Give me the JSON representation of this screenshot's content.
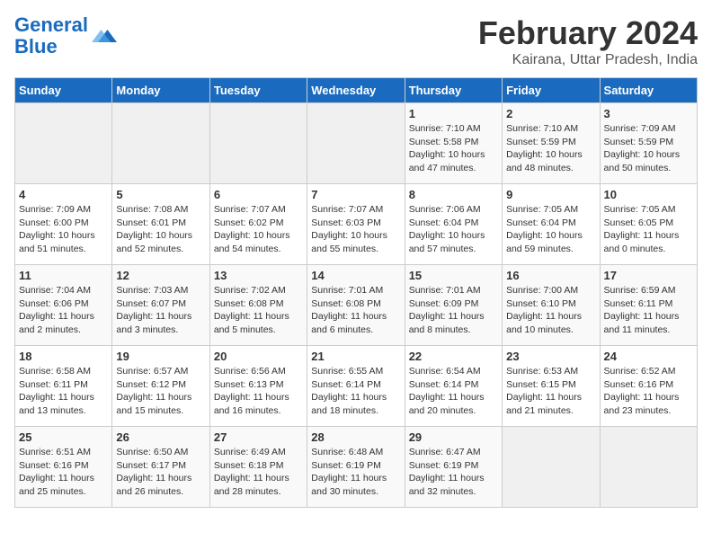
{
  "header": {
    "logo_line1": "General",
    "logo_line2": "Blue",
    "main_title": "February 2024",
    "subtitle": "Kairana, Uttar Pradesh, India"
  },
  "days_of_week": [
    "Sunday",
    "Monday",
    "Tuesday",
    "Wednesday",
    "Thursday",
    "Friday",
    "Saturday"
  ],
  "weeks": [
    [
      {
        "day": "",
        "info": ""
      },
      {
        "day": "",
        "info": ""
      },
      {
        "day": "",
        "info": ""
      },
      {
        "day": "",
        "info": ""
      },
      {
        "day": "1",
        "info": "Sunrise: 7:10 AM\nSunset: 5:58 PM\nDaylight: 10 hours\nand 47 minutes."
      },
      {
        "day": "2",
        "info": "Sunrise: 7:10 AM\nSunset: 5:59 PM\nDaylight: 10 hours\nand 48 minutes."
      },
      {
        "day": "3",
        "info": "Sunrise: 7:09 AM\nSunset: 5:59 PM\nDaylight: 10 hours\nand 50 minutes."
      }
    ],
    [
      {
        "day": "4",
        "info": "Sunrise: 7:09 AM\nSunset: 6:00 PM\nDaylight: 10 hours\nand 51 minutes."
      },
      {
        "day": "5",
        "info": "Sunrise: 7:08 AM\nSunset: 6:01 PM\nDaylight: 10 hours\nand 52 minutes."
      },
      {
        "day": "6",
        "info": "Sunrise: 7:07 AM\nSunset: 6:02 PM\nDaylight: 10 hours\nand 54 minutes."
      },
      {
        "day": "7",
        "info": "Sunrise: 7:07 AM\nSunset: 6:03 PM\nDaylight: 10 hours\nand 55 minutes."
      },
      {
        "day": "8",
        "info": "Sunrise: 7:06 AM\nSunset: 6:04 PM\nDaylight: 10 hours\nand 57 minutes."
      },
      {
        "day": "9",
        "info": "Sunrise: 7:05 AM\nSunset: 6:04 PM\nDaylight: 10 hours\nand 59 minutes."
      },
      {
        "day": "10",
        "info": "Sunrise: 7:05 AM\nSunset: 6:05 PM\nDaylight: 11 hours\nand 0 minutes."
      }
    ],
    [
      {
        "day": "11",
        "info": "Sunrise: 7:04 AM\nSunset: 6:06 PM\nDaylight: 11 hours\nand 2 minutes."
      },
      {
        "day": "12",
        "info": "Sunrise: 7:03 AM\nSunset: 6:07 PM\nDaylight: 11 hours\nand 3 minutes."
      },
      {
        "day": "13",
        "info": "Sunrise: 7:02 AM\nSunset: 6:08 PM\nDaylight: 11 hours\nand 5 minutes."
      },
      {
        "day": "14",
        "info": "Sunrise: 7:01 AM\nSunset: 6:08 PM\nDaylight: 11 hours\nand 6 minutes."
      },
      {
        "day": "15",
        "info": "Sunrise: 7:01 AM\nSunset: 6:09 PM\nDaylight: 11 hours\nand 8 minutes."
      },
      {
        "day": "16",
        "info": "Sunrise: 7:00 AM\nSunset: 6:10 PM\nDaylight: 11 hours\nand 10 minutes."
      },
      {
        "day": "17",
        "info": "Sunrise: 6:59 AM\nSunset: 6:11 PM\nDaylight: 11 hours\nand 11 minutes."
      }
    ],
    [
      {
        "day": "18",
        "info": "Sunrise: 6:58 AM\nSunset: 6:11 PM\nDaylight: 11 hours\nand 13 minutes."
      },
      {
        "day": "19",
        "info": "Sunrise: 6:57 AM\nSunset: 6:12 PM\nDaylight: 11 hours\nand 15 minutes."
      },
      {
        "day": "20",
        "info": "Sunrise: 6:56 AM\nSunset: 6:13 PM\nDaylight: 11 hours\nand 16 minutes."
      },
      {
        "day": "21",
        "info": "Sunrise: 6:55 AM\nSunset: 6:14 PM\nDaylight: 11 hours\nand 18 minutes."
      },
      {
        "day": "22",
        "info": "Sunrise: 6:54 AM\nSunset: 6:14 PM\nDaylight: 11 hours\nand 20 minutes."
      },
      {
        "day": "23",
        "info": "Sunrise: 6:53 AM\nSunset: 6:15 PM\nDaylight: 11 hours\nand 21 minutes."
      },
      {
        "day": "24",
        "info": "Sunrise: 6:52 AM\nSunset: 6:16 PM\nDaylight: 11 hours\nand 23 minutes."
      }
    ],
    [
      {
        "day": "25",
        "info": "Sunrise: 6:51 AM\nSunset: 6:16 PM\nDaylight: 11 hours\nand 25 minutes."
      },
      {
        "day": "26",
        "info": "Sunrise: 6:50 AM\nSunset: 6:17 PM\nDaylight: 11 hours\nand 26 minutes."
      },
      {
        "day": "27",
        "info": "Sunrise: 6:49 AM\nSunset: 6:18 PM\nDaylight: 11 hours\nand 28 minutes."
      },
      {
        "day": "28",
        "info": "Sunrise: 6:48 AM\nSunset: 6:19 PM\nDaylight: 11 hours\nand 30 minutes."
      },
      {
        "day": "29",
        "info": "Sunrise: 6:47 AM\nSunset: 6:19 PM\nDaylight: 11 hours\nand 32 minutes."
      },
      {
        "day": "",
        "info": ""
      },
      {
        "day": "",
        "info": ""
      }
    ]
  ]
}
